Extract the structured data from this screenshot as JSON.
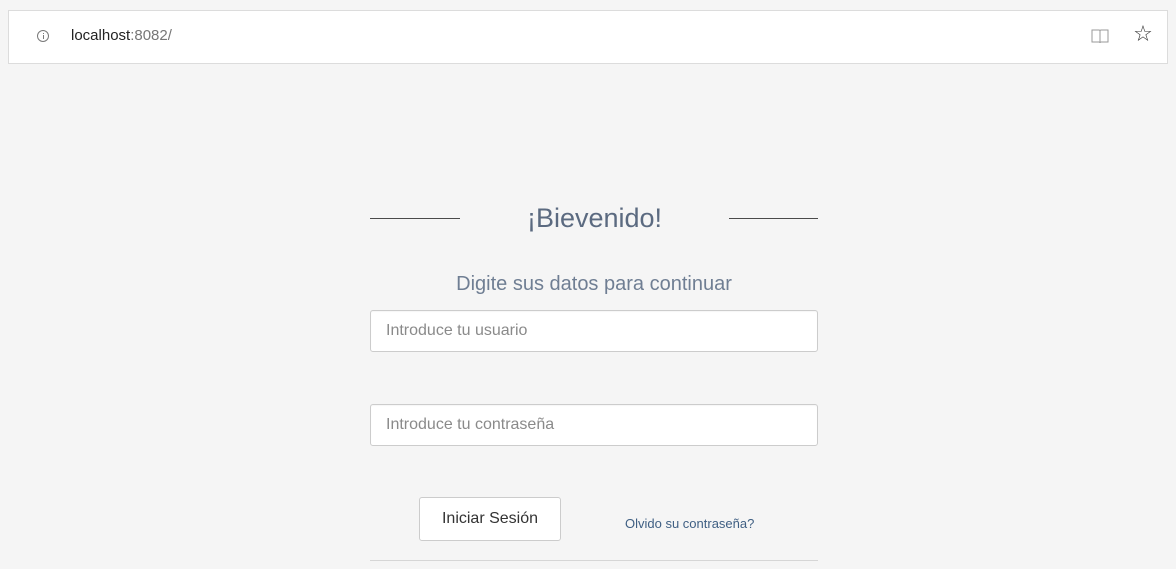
{
  "browser": {
    "url_host": "localhost",
    "url_rest": ":8082/",
    "icons": {
      "info": "info-icon",
      "reading_view": "book-icon",
      "favorite": "star-icon"
    }
  },
  "login": {
    "title": "¡Bievenido!",
    "subtitle": "Digite sus datos para continuar",
    "username_placeholder": "Introduce tu usuario",
    "username_value": "",
    "password_placeholder": "Introduce tu contraseña",
    "password_value": "",
    "submit_label": "Iniciar Sesión",
    "forgot_label": "Olvido su contraseña?"
  },
  "colors": {
    "background": "#f5f5f5",
    "title": "#5b6a80",
    "subtitle": "#6f7e93",
    "link": "#3f5f83"
  }
}
